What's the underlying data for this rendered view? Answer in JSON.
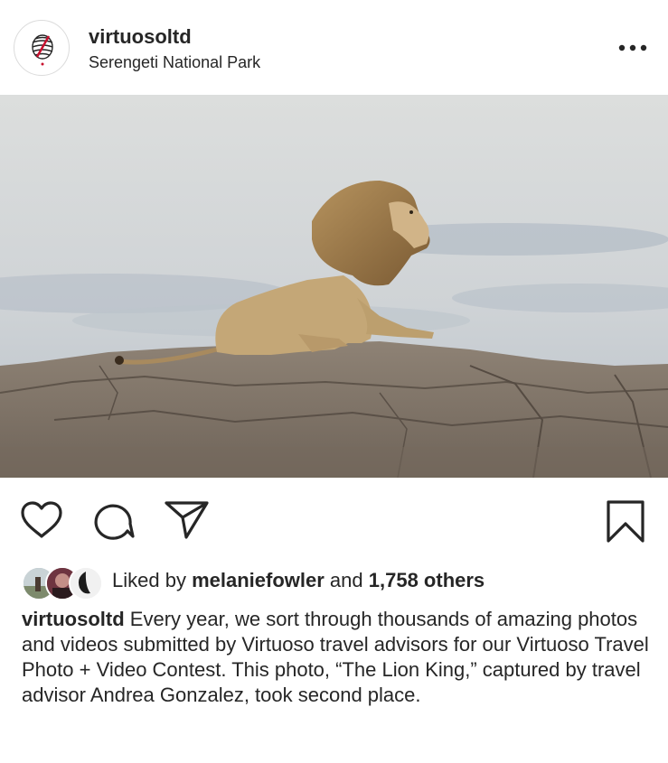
{
  "post": {
    "username": "virtuosoltd",
    "location": "Serengeti National Park",
    "more_icon": "ellipsis-icon"
  },
  "actions": {
    "like_icon": "heart-icon",
    "comment_icon": "comment-icon",
    "share_icon": "send-icon",
    "save_icon": "bookmark-icon"
  },
  "likes": {
    "prefix": "Liked by",
    "liker": "melaniefowler",
    "conjunction": "and",
    "others": "1,758 others"
  },
  "caption": {
    "username": "virtuosoltd",
    "text": "Every year, we sort through thousands of amazing photos and videos submitted by Virtuoso travel advisors for our Virtuoso Travel Photo + Video Contest. This photo, “The Lion King,” captured by travel advisor Andrea Gonzalez, took second place."
  },
  "colors": {
    "text": "#262626",
    "border": "#dbdbdb",
    "brand_red": "#c8102e"
  }
}
